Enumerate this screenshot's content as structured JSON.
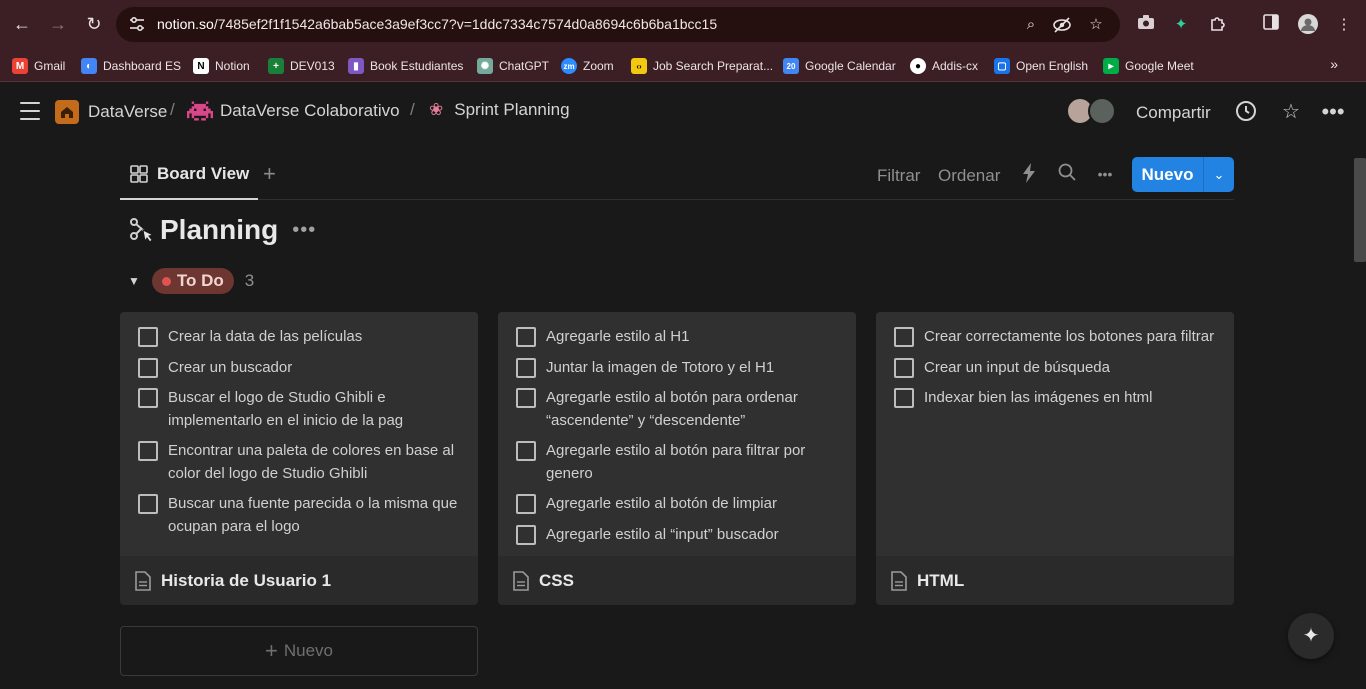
{
  "browser": {
    "url_host": "notion.so",
    "url_path": "/7485ef2f1f1542a6bab5ace3a9ef3cc7?v=1ddc7334c7574d0a8694c6b6ba1bcc15",
    "bookmarks": [
      {
        "label": "Gmail",
        "icon": "gmail-icon",
        "color": "#ea4335"
      },
      {
        "label": "Dashboard ES",
        "icon": "dashboard-icon",
        "color": "#4285f4"
      },
      {
        "label": "Notion",
        "icon": "notion-icon",
        "color": "#ffffff"
      },
      {
        "label": "DEV013",
        "icon": "sheets-icon",
        "color": "#188038"
      },
      {
        "label": "Book Estudiantes",
        "icon": "book-icon",
        "color": "#7e57c2"
      },
      {
        "label": "ChatGPT",
        "icon": "chatgpt-icon",
        "color": "#74aa9c"
      },
      {
        "label": "Zoom",
        "icon": "zoom-icon",
        "color": "#2d8cff"
      },
      {
        "label": "Job Search Preparat...",
        "icon": "job-icon",
        "color": "#f2c811"
      },
      {
        "label": "Google Calendar",
        "icon": "calendar-icon",
        "color": "#4285f4"
      },
      {
        "label": "Addis-cx",
        "icon": "github-icon",
        "color": "#ffffff"
      },
      {
        "label": "Open English",
        "icon": "open-english-icon",
        "color": "#1a73e8"
      },
      {
        "label": "Google Meet",
        "icon": "meet-icon",
        "color": "#00ac47"
      }
    ]
  },
  "breadcrumb": {
    "workspace": "DataVerse",
    "teamspace": "DataVerse Colaborativo",
    "page": "Sprint Planning"
  },
  "topbar": {
    "share_label": "Compartir"
  },
  "viewbar": {
    "tab_label": "Board View",
    "filter_label": "Filtrar",
    "sort_label": "Ordenar",
    "new_label": "Nuevo"
  },
  "board": {
    "title": "Planning",
    "group": {
      "status": "To Do",
      "count": "3",
      "status_color": "#df5452"
    },
    "cards": [
      {
        "name": "Historia de Usuario 1",
        "todos": [
          "Crear la data de las películas",
          "Crear un buscador",
          "Buscar el logo de Studio Ghibli e implementarlo en el inicio de la pag",
          "Encontrar una paleta de colores en base al color del logo de Studio Ghibli",
          "Buscar una fuente parecida o la misma que ocupan para el logo"
        ]
      },
      {
        "name": "CSS",
        "todos": [
          "Agregarle estilo al H1",
          "Juntar la imagen de Totoro y el H1",
          "Agregarle estilo al botón para ordenar “ascendente” y “descendente”",
          "Agregarle estilo al botón para filtrar por genero",
          "Agregarle estilo al botón de limpiar",
          "Agregarle estilo al “input” buscador"
        ]
      },
      {
        "name": "HTML",
        "todos": [
          "Crear correctamente los botones para filtrar",
          "Crear un input de búsqueda",
          "Indexar bien las imágenes en html"
        ]
      }
    ],
    "add_new_label": "Nuevo"
  }
}
